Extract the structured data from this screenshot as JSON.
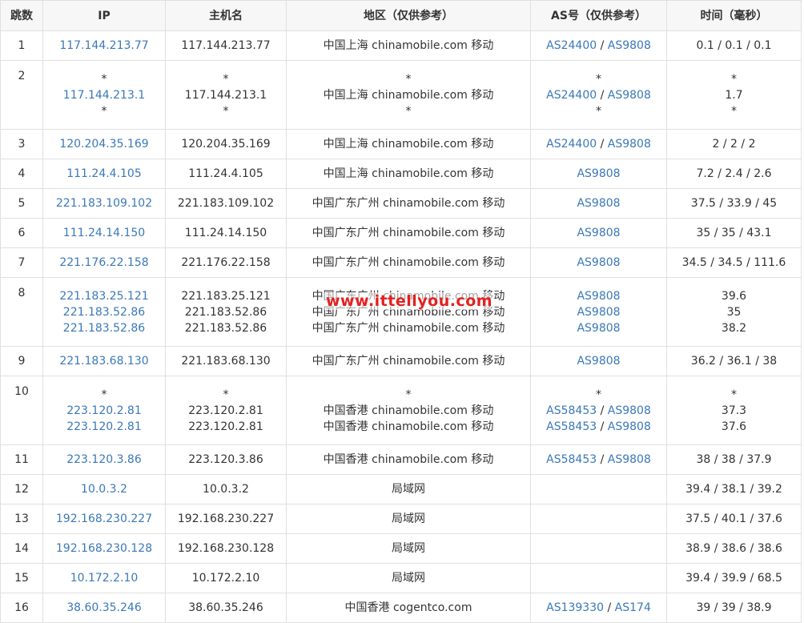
{
  "headers": {
    "hop": "跳数",
    "ip": "IP",
    "host": "主机名",
    "region": "地区（仅供参考）",
    "as": "AS号（仅供参考）",
    "time": "时间（毫秒）"
  },
  "watermark": "www.ittellyou.com",
  "colors": {
    "link": "#3b78b8",
    "watermark": "#e4201f",
    "border": "#e0e0e0",
    "header_bg": "#f7f7f7"
  },
  "rows": [
    {
      "hop": "1",
      "ip": [
        "117.144.213.77"
      ],
      "host": [
        "117.144.213.77"
      ],
      "region": [
        "中国上海 chinamobile.com 移动"
      ],
      "as": [
        [
          "AS24400",
          "AS9808"
        ]
      ],
      "time": [
        "0.1 / 0.1 / 0.1"
      ]
    },
    {
      "hop": "2",
      "ip": [
        "*",
        "117.144.213.1",
        "*"
      ],
      "host": [
        "*",
        "117.144.213.1",
        "*"
      ],
      "region": [
        "*",
        "中国上海 chinamobile.com 移动",
        "*"
      ],
      "as": [
        [
          "*"
        ],
        [
          "AS24400",
          "AS9808"
        ],
        [
          "*"
        ]
      ],
      "time": [
        "*",
        "1.7",
        "*"
      ]
    },
    {
      "hop": "3",
      "ip": [
        "120.204.35.169"
      ],
      "host": [
        "120.204.35.169"
      ],
      "region": [
        "中国上海 chinamobile.com 移动"
      ],
      "as": [
        [
          "AS24400",
          "AS9808"
        ]
      ],
      "time": [
        "2 / 2 / 2"
      ]
    },
    {
      "hop": "4",
      "ip": [
        "111.24.4.105"
      ],
      "host": [
        "111.24.4.105"
      ],
      "region": [
        "中国上海 chinamobile.com 移动"
      ],
      "as": [
        [
          "AS9808"
        ]
      ],
      "time": [
        "7.2 / 2.4 / 2.6"
      ]
    },
    {
      "hop": "5",
      "ip": [
        "221.183.109.102"
      ],
      "host": [
        "221.183.109.102"
      ],
      "region": [
        "中国广东广州 chinamobile.com 移动"
      ],
      "as": [
        [
          "AS9808"
        ]
      ],
      "time": [
        "37.5 / 33.9 / 45"
      ]
    },
    {
      "hop": "6",
      "ip": [
        "111.24.14.150"
      ],
      "host": [
        "111.24.14.150"
      ],
      "region": [
        "中国广东广州 chinamobile.com 移动"
      ],
      "as": [
        [
          "AS9808"
        ]
      ],
      "time": [
        "35 / 35 / 43.1"
      ]
    },
    {
      "hop": "7",
      "ip": [
        "221.176.22.158"
      ],
      "host": [
        "221.176.22.158"
      ],
      "region": [
        "中国广东广州 chinamobile.com 移动"
      ],
      "as": [
        [
          "AS9808"
        ]
      ],
      "time": [
        "34.5 / 34.5 / 111.6"
      ]
    },
    {
      "hop": "8",
      "ip": [
        "221.183.25.121",
        "221.183.52.86",
        "221.183.52.86"
      ],
      "host": [
        "221.183.25.121",
        "221.183.52.86",
        "221.183.52.86"
      ],
      "region": [
        "中国广东广州 chinamobile.com 移动",
        "中国广东广州 chinamobile.com 移动",
        "中国广东广州 chinamobile.com 移动"
      ],
      "as": [
        [
          "AS9808"
        ],
        [
          "AS9808"
        ],
        [
          "AS9808"
        ]
      ],
      "time": [
        "39.6",
        "35",
        "38.2"
      ]
    },
    {
      "hop": "9",
      "ip": [
        "221.183.68.130"
      ],
      "host": [
        "221.183.68.130"
      ],
      "region": [
        "中国广东广州 chinamobile.com 移动"
      ],
      "as": [
        [
          "AS9808"
        ]
      ],
      "time": [
        "36.2 / 36.1 / 38"
      ]
    },
    {
      "hop": "10",
      "ip": [
        "*",
        "223.120.2.81",
        "223.120.2.81"
      ],
      "host": [
        "*",
        "223.120.2.81",
        "223.120.2.81"
      ],
      "region": [
        "*",
        "中国香港 chinamobile.com 移动",
        "中国香港 chinamobile.com 移动"
      ],
      "as": [
        [
          "*"
        ],
        [
          "AS58453",
          "AS9808"
        ],
        [
          "AS58453",
          "AS9808"
        ]
      ],
      "time": [
        "*",
        "37.3",
        "37.6"
      ]
    },
    {
      "hop": "11",
      "ip": [
        "223.120.3.86"
      ],
      "host": [
        "223.120.3.86"
      ],
      "region": [
        "中国香港 chinamobile.com 移动"
      ],
      "as": [
        [
          "AS58453",
          "AS9808"
        ]
      ],
      "time": [
        "38 / 38 / 37.9"
      ]
    },
    {
      "hop": "12",
      "ip": [
        "10.0.3.2"
      ],
      "host": [
        "10.0.3.2"
      ],
      "region": [
        "局域网"
      ],
      "as": [
        []
      ],
      "time": [
        "39.4 / 38.1 / 39.2"
      ]
    },
    {
      "hop": "13",
      "ip": [
        "192.168.230.227"
      ],
      "host": [
        "192.168.230.227"
      ],
      "region": [
        "局域网"
      ],
      "as": [
        []
      ],
      "time": [
        "37.5 / 40.1 / 37.6"
      ]
    },
    {
      "hop": "14",
      "ip": [
        "192.168.230.128"
      ],
      "host": [
        "192.168.230.128"
      ],
      "region": [
        "局域网"
      ],
      "as": [
        []
      ],
      "time": [
        "38.9 / 38.6 / 38.6"
      ]
    },
    {
      "hop": "15",
      "ip": [
        "10.172.2.10"
      ],
      "host": [
        "10.172.2.10"
      ],
      "region": [
        "局域网"
      ],
      "as": [
        []
      ],
      "time": [
        "39.4 / 39.9 / 68.5"
      ]
    },
    {
      "hop": "16",
      "ip": [
        "38.60.35.246"
      ],
      "host": [
        "38.60.35.246"
      ],
      "region": [
        "中国香港 cogentco.com"
      ],
      "as": [
        [
          "AS139330",
          "AS174"
        ]
      ],
      "time": [
        "39 / 39 / 38.9"
      ]
    }
  ]
}
